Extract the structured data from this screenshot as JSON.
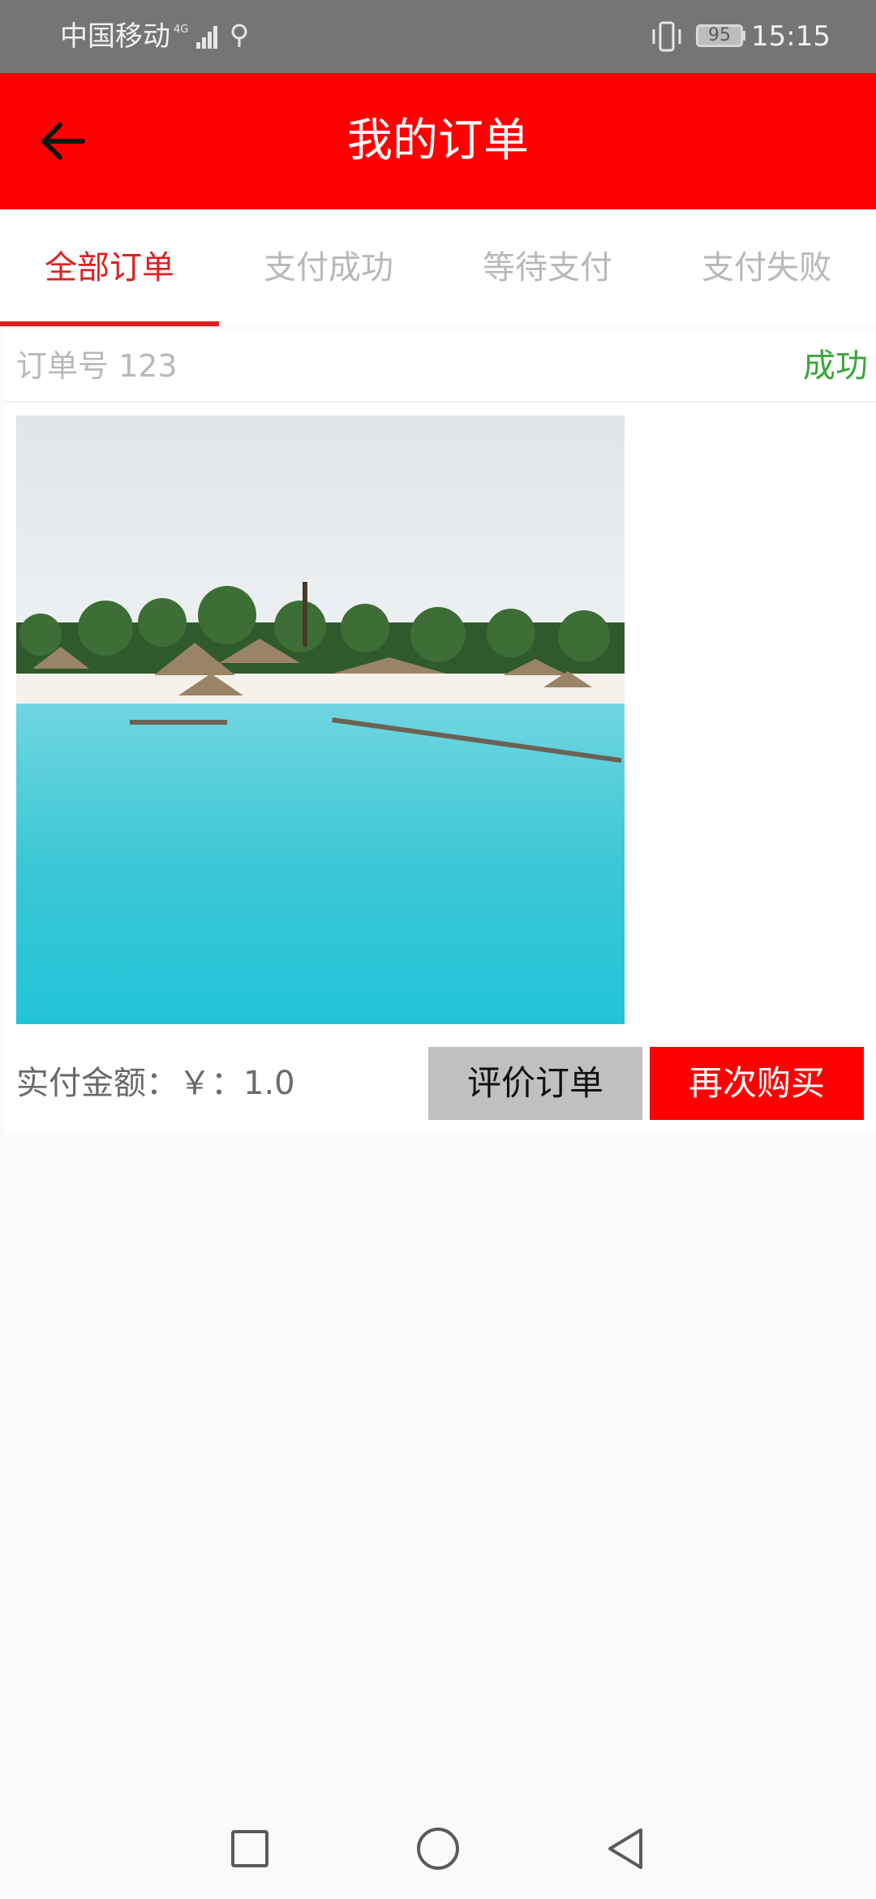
{
  "status_bar": {
    "carrier": "中国移动",
    "network": "4G",
    "battery": "95",
    "time": "15:15"
  },
  "header": {
    "title": "我的订单",
    "back_icon": "arrow-left-icon"
  },
  "tabs": [
    {
      "label": "全部订单",
      "active": true
    },
    {
      "label": "支付成功",
      "active": false
    },
    {
      "label": "等待支付",
      "active": false
    },
    {
      "label": "支付失败",
      "active": false
    }
  ],
  "order": {
    "number_label": "订单号 123",
    "status": "成功",
    "amount_label": "实付金额：￥：1.0",
    "review_button": "评价订单",
    "rebuy_button": "再次购买"
  },
  "colors": {
    "accent": "#ff0000",
    "tab_active": "#e01e1e",
    "status_success": "#3aa63a",
    "status_bar": "#757575"
  },
  "nav_bar": {
    "icons": [
      "recents-square-icon",
      "home-circle-icon",
      "back-triangle-icon"
    ]
  }
}
